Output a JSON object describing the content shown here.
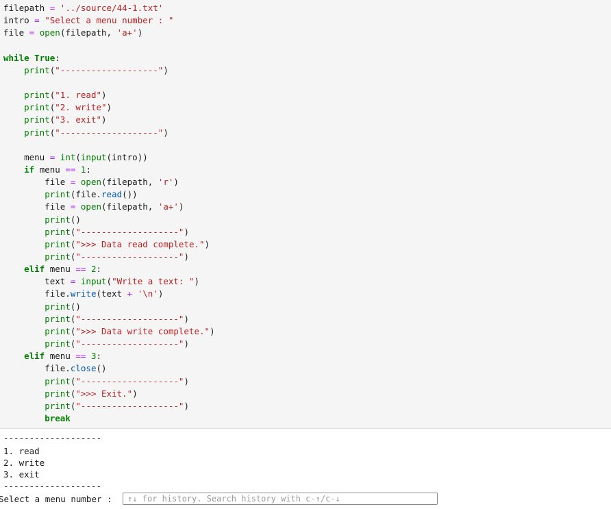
{
  "code_cell": {
    "lines": [
      [
        [
          "plain",
          "filepath "
        ],
        [
          "op",
          "="
        ],
        [
          "plain",
          " "
        ],
        [
          "st",
          "'../source/44-1.txt'"
        ]
      ],
      [
        [
          "plain",
          "intro "
        ],
        [
          "op",
          "="
        ],
        [
          "plain",
          " "
        ],
        [
          "st",
          "\"Select a menu number : \""
        ]
      ],
      [
        [
          "plain",
          "file "
        ],
        [
          "op",
          "="
        ],
        [
          "plain",
          " "
        ],
        [
          "bi",
          "open"
        ],
        [
          "plain",
          "(filepath, "
        ],
        [
          "st",
          "'a+'"
        ],
        [
          "plain",
          ")"
        ]
      ],
      [],
      [
        [
          "kw",
          "while"
        ],
        [
          "plain",
          " "
        ],
        [
          "kw",
          "True"
        ],
        [
          "plain",
          ":"
        ]
      ],
      [
        [
          "plain",
          "    "
        ],
        [
          "bi",
          "print"
        ],
        [
          "plain",
          "("
        ],
        [
          "st",
          "\"-------------------\""
        ],
        [
          "plain",
          ")"
        ]
      ],
      [],
      [
        [
          "plain",
          "    "
        ],
        [
          "bi",
          "print"
        ],
        [
          "plain",
          "("
        ],
        [
          "st",
          "\"1. read\""
        ],
        [
          "plain",
          ")"
        ]
      ],
      [
        [
          "plain",
          "    "
        ],
        [
          "bi",
          "print"
        ],
        [
          "plain",
          "("
        ],
        [
          "st",
          "\"2. write\""
        ],
        [
          "plain",
          ")"
        ]
      ],
      [
        [
          "plain",
          "    "
        ],
        [
          "bi",
          "print"
        ],
        [
          "plain",
          "("
        ],
        [
          "st",
          "\"3. exit\""
        ],
        [
          "plain",
          ")"
        ]
      ],
      [
        [
          "plain",
          "    "
        ],
        [
          "bi",
          "print"
        ],
        [
          "plain",
          "("
        ],
        [
          "st",
          "\"-------------------\""
        ],
        [
          "plain",
          ")"
        ]
      ],
      [],
      [
        [
          "plain",
          "    menu "
        ],
        [
          "op",
          "="
        ],
        [
          "plain",
          " "
        ],
        [
          "bi",
          "int"
        ],
        [
          "plain",
          "("
        ],
        [
          "bi",
          "input"
        ],
        [
          "plain",
          "(intro))"
        ]
      ],
      [
        [
          "plain",
          "    "
        ],
        [
          "kw",
          "if"
        ],
        [
          "plain",
          " menu "
        ],
        [
          "op",
          "=="
        ],
        [
          "plain",
          " "
        ],
        [
          "nm",
          "1"
        ],
        [
          "plain",
          ":"
        ]
      ],
      [
        [
          "plain",
          "        file "
        ],
        [
          "op",
          "="
        ],
        [
          "plain",
          " "
        ],
        [
          "bi",
          "open"
        ],
        [
          "plain",
          "(filepath, "
        ],
        [
          "st",
          "'r'"
        ],
        [
          "plain",
          ")"
        ]
      ],
      [
        [
          "plain",
          "        "
        ],
        [
          "bi",
          "print"
        ],
        [
          "plain",
          "(file."
        ],
        [
          "at",
          "read"
        ],
        [
          "plain",
          "())"
        ]
      ],
      [
        [
          "plain",
          "        file "
        ],
        [
          "op",
          "="
        ],
        [
          "plain",
          " "
        ],
        [
          "bi",
          "open"
        ],
        [
          "plain",
          "(filepath, "
        ],
        [
          "st",
          "'a+'"
        ],
        [
          "plain",
          ")"
        ]
      ],
      [
        [
          "plain",
          "        "
        ],
        [
          "bi",
          "print"
        ],
        [
          "plain",
          "()"
        ]
      ],
      [
        [
          "plain",
          "        "
        ],
        [
          "bi",
          "print"
        ],
        [
          "plain",
          "("
        ],
        [
          "st",
          "\"-------------------\""
        ],
        [
          "plain",
          ")"
        ]
      ],
      [
        [
          "plain",
          "        "
        ],
        [
          "bi",
          "print"
        ],
        [
          "plain",
          "("
        ],
        [
          "st",
          "\">>> Data read complete.\""
        ],
        [
          "plain",
          ")"
        ]
      ],
      [
        [
          "plain",
          "        "
        ],
        [
          "bi",
          "print"
        ],
        [
          "plain",
          "("
        ],
        [
          "st",
          "\"-------------------\""
        ],
        [
          "plain",
          ")"
        ]
      ],
      [
        [
          "plain",
          "    "
        ],
        [
          "kw",
          "elif"
        ],
        [
          "plain",
          " menu "
        ],
        [
          "op",
          "=="
        ],
        [
          "plain",
          " "
        ],
        [
          "nm",
          "2"
        ],
        [
          "plain",
          ":"
        ]
      ],
      [
        [
          "plain",
          "        text "
        ],
        [
          "op",
          "="
        ],
        [
          "plain",
          " "
        ],
        [
          "bi",
          "input"
        ],
        [
          "plain",
          "("
        ],
        [
          "st",
          "\"Write a text: \""
        ],
        [
          "plain",
          ")"
        ]
      ],
      [
        [
          "plain",
          "        file."
        ],
        [
          "at",
          "write"
        ],
        [
          "plain",
          "(text "
        ],
        [
          "op",
          "+"
        ],
        [
          "plain",
          " "
        ],
        [
          "st",
          "'\\n'"
        ],
        [
          "plain",
          ")"
        ]
      ],
      [
        [
          "plain",
          "        "
        ],
        [
          "bi",
          "print"
        ],
        [
          "plain",
          "()"
        ]
      ],
      [
        [
          "plain",
          "        "
        ],
        [
          "bi",
          "print"
        ],
        [
          "plain",
          "("
        ],
        [
          "st",
          "\"-------------------\""
        ],
        [
          "plain",
          ")"
        ]
      ],
      [
        [
          "plain",
          "        "
        ],
        [
          "bi",
          "print"
        ],
        [
          "plain",
          "("
        ],
        [
          "st",
          "\">>> Data write complete.\""
        ],
        [
          "plain",
          ")"
        ]
      ],
      [
        [
          "plain",
          "        "
        ],
        [
          "bi",
          "print"
        ],
        [
          "plain",
          "("
        ],
        [
          "st",
          "\"-------------------\""
        ],
        [
          "plain",
          ")"
        ]
      ],
      [
        [
          "plain",
          "    "
        ],
        [
          "kw",
          "elif"
        ],
        [
          "plain",
          " menu "
        ],
        [
          "op",
          "=="
        ],
        [
          "plain",
          " "
        ],
        [
          "nm",
          "3"
        ],
        [
          "plain",
          ":"
        ]
      ],
      [
        [
          "plain",
          "        file."
        ],
        [
          "at",
          "close"
        ],
        [
          "plain",
          "()"
        ]
      ],
      [
        [
          "plain",
          "        "
        ],
        [
          "bi",
          "print"
        ],
        [
          "plain",
          "("
        ],
        [
          "st",
          "\"-------------------\""
        ],
        [
          "plain",
          ")"
        ]
      ],
      [
        [
          "plain",
          "        "
        ],
        [
          "bi",
          "print"
        ],
        [
          "plain",
          "("
        ],
        [
          "st",
          "\">>> Exit.\""
        ],
        [
          "plain",
          ")"
        ]
      ],
      [
        [
          "plain",
          "        "
        ],
        [
          "bi",
          "print"
        ],
        [
          "plain",
          "("
        ],
        [
          "st",
          "\"-------------------\""
        ],
        [
          "plain",
          ")"
        ]
      ],
      [
        [
          "plain",
          "        "
        ],
        [
          "kw",
          "break"
        ]
      ]
    ]
  },
  "output": {
    "lines": [
      "-------------------",
      "1. read",
      "2. write",
      "3. exit",
      "-------------------"
    ],
    "prompt_label": "Select a menu number : ",
    "stdin_value": "",
    "stdin_placeholder": "↑↓ for history. Search history with c-↑/c-↓"
  },
  "colors": {
    "keyword": "#008000",
    "string": "#ba2121",
    "operator": "#aa22ff",
    "attribute": "#0055aa",
    "cell_background": "#f5f5f5"
  }
}
